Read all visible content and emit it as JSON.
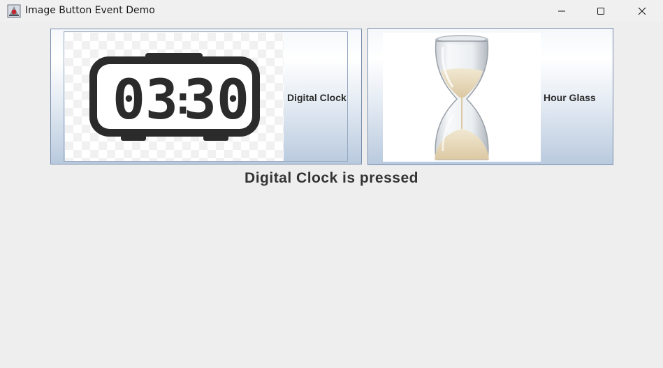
{
  "window": {
    "title": "Image Button Event Demo",
    "controls": [
      "minimize-icon",
      "maximize-icon",
      "close-icon"
    ]
  },
  "buttons": [
    {
      "label": "Digital Clock",
      "image": "digital-clock-image",
      "clock_display": {
        "hours": "03",
        "separator": ":",
        "minutes": "30"
      },
      "state": "focused"
    },
    {
      "label": "Hour Glass",
      "image": "hourglass-image",
      "state": "normal"
    }
  ],
  "status": {
    "text": "Digital Clock is pressed"
  },
  "colors": {
    "button_border": "#7a8fae",
    "button_gradient_bottom": "#b9cade",
    "window_bg": "#eeeeee",
    "sand": "#e8dcc0"
  }
}
